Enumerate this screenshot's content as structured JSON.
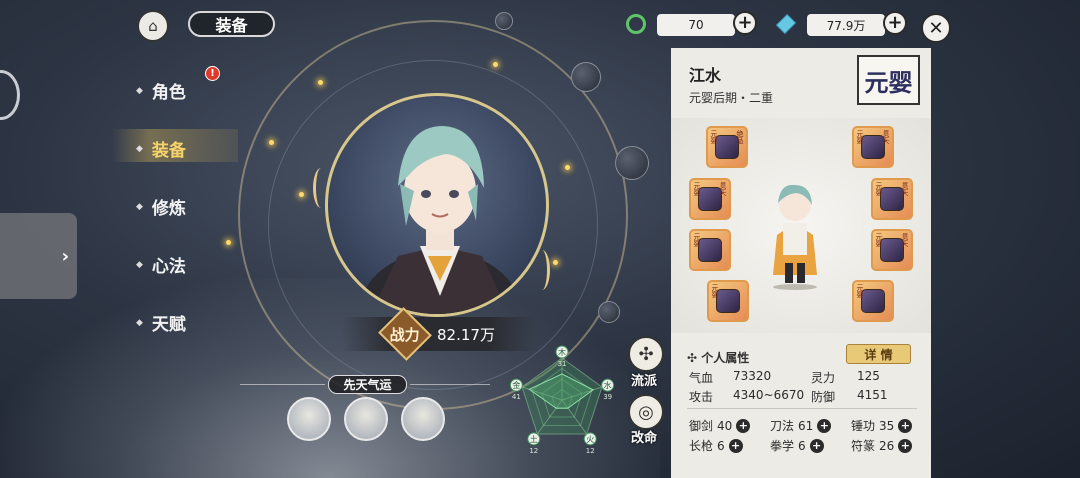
{
  "header": {
    "title": "装备",
    "home_icon": "pavilion-icon",
    "currency1": {
      "icon": "jade-ring-icon",
      "value": "70"
    },
    "currency2": {
      "icon": "spirit-crystal-icon",
      "value": "77.9万"
    },
    "plus": "+",
    "close": "✕"
  },
  "nav": {
    "items": [
      {
        "label": "角色",
        "active": false,
        "badge": "!"
      },
      {
        "label": "装备",
        "active": true
      },
      {
        "label": "修炼",
        "active": false
      },
      {
        "label": "心法",
        "active": false
      },
      {
        "label": "天赋",
        "active": false
      }
    ],
    "side_tab_arrow": "›"
  },
  "portrait": {
    "power_label": "战力",
    "power_value": "82.17万"
  },
  "luck": {
    "title": "先天气运"
  },
  "radar": {
    "labels": [
      "木",
      "水",
      "火",
      "土",
      "金"
    ],
    "values": [
      31,
      39,
      12,
      12,
      41
    ],
    "value_labels": [
      "31",
      "39",
      "12",
      "12",
      "41"
    ]
  },
  "side_buttons": {
    "school_label": "流派",
    "fate_label": "改命"
  },
  "panel": {
    "name": "江水",
    "realm": "元婴后期・二重",
    "seal_text": "元婴",
    "slots_left": [
      {
        "rank": "元婴",
        "tag": "绝品"
      },
      {
        "rank": "元婴",
        "tag": "贯天"
      },
      {
        "rank": "元婴",
        "tag": ""
      },
      {
        "rank": "元婴",
        "tag": ""
      }
    ],
    "slots_right": [
      {
        "rank": "元婴",
        "tag": "贯天"
      },
      {
        "rank": "元婴",
        "tag": "贯天"
      },
      {
        "rank": "元婴",
        "tag": "贯天"
      },
      {
        "rank": "元婴",
        "tag": ""
      }
    ],
    "attr_title": "个人属性",
    "detail_btn": "详 情",
    "stats": {
      "hp_label": "气血",
      "hp": "73320",
      "sp_label": "灵力",
      "sp": "125",
      "atk_label": "攻击",
      "atk": "4340~6670",
      "def_label": "防御",
      "def": "4151"
    },
    "skills": [
      {
        "label": "御剑",
        "value": "40"
      },
      {
        "label": "刀法",
        "value": "61"
      },
      {
        "label": "锤功",
        "value": "35"
      },
      {
        "label": "长枪",
        "value": "6"
      },
      {
        "label": "拳学",
        "value": "6"
      },
      {
        "label": "符篆",
        "value": "26"
      }
    ]
  },
  "colors": {
    "accent_gold": "#f7d46b",
    "panel_bg": "#ecebe6",
    "slot_orange": "#e58c54",
    "radar_green": "#3f8f5a"
  }
}
